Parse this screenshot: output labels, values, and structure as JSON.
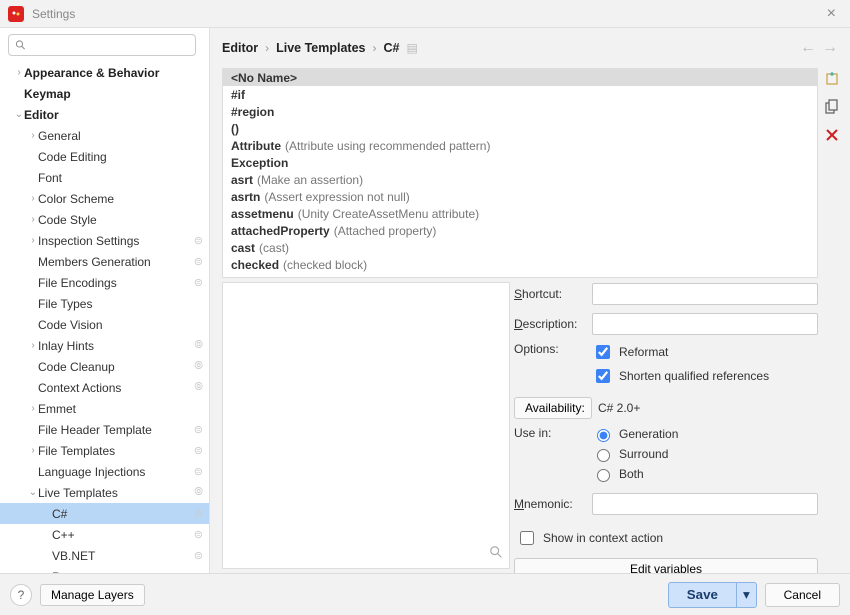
{
  "window": {
    "title": "Settings"
  },
  "search": {
    "placeholder": ""
  },
  "tree": [
    {
      "label": "Appearance & Behavior",
      "depth": 0,
      "chev": "›",
      "bold": true
    },
    {
      "label": "Keymap",
      "depth": 0,
      "chev": "",
      "bold": true
    },
    {
      "label": "Editor",
      "depth": 0,
      "chev": "⌄",
      "bold": true
    },
    {
      "label": "General",
      "depth": 1,
      "chev": "›"
    },
    {
      "label": "Code Editing",
      "depth": 1,
      "chev": ""
    },
    {
      "label": "Font",
      "depth": 1,
      "chev": ""
    },
    {
      "label": "Color Scheme",
      "depth": 1,
      "chev": "›"
    },
    {
      "label": "Code Style",
      "depth": 1,
      "chev": "›"
    },
    {
      "label": "Inspection Settings",
      "depth": 1,
      "chev": "›",
      "badge": "⊜"
    },
    {
      "label": "Members Generation",
      "depth": 1,
      "chev": "",
      "badge": "⊜"
    },
    {
      "label": "File Encodings",
      "depth": 1,
      "chev": "",
      "badge": "⊜"
    },
    {
      "label": "File Types",
      "depth": 1,
      "chev": ""
    },
    {
      "label": "Code Vision",
      "depth": 1,
      "chev": ""
    },
    {
      "label": "Inlay Hints",
      "depth": 1,
      "chev": "›",
      "badge": "⦾"
    },
    {
      "label": "Code Cleanup",
      "depth": 1,
      "chev": "",
      "badge": "⦾"
    },
    {
      "label": "Context Actions",
      "depth": 1,
      "chev": "",
      "badge": "⦾"
    },
    {
      "label": "Emmet",
      "depth": 1,
      "chev": "›"
    },
    {
      "label": "File Header Template",
      "depth": 1,
      "chev": "",
      "badge": "⊜"
    },
    {
      "label": "File Templates",
      "depth": 1,
      "chev": "›",
      "badge": "⊜"
    },
    {
      "label": "Language Injections",
      "depth": 1,
      "chev": "",
      "badge": "⊜"
    },
    {
      "label": "Live Templates",
      "depth": 1,
      "chev": "⌄",
      "badge": "⦾"
    },
    {
      "label": "C#",
      "depth": 2,
      "chev": "",
      "selected": true,
      "badge": "⊜"
    },
    {
      "label": "C++",
      "depth": 2,
      "chev": "",
      "badge": "⊜"
    },
    {
      "label": "VB.NET",
      "depth": 2,
      "chev": "",
      "badge": "⊜"
    },
    {
      "label": "Razor",
      "depth": 2,
      "chev": "",
      "badge": "⊜"
    }
  ],
  "breadcrumb": [
    "Editor",
    "Live Templates",
    "C#"
  ],
  "templates": [
    {
      "shortcut": "<No Name>",
      "desc": "",
      "selected": true
    },
    {
      "shortcut": "#if",
      "desc": ""
    },
    {
      "shortcut": "#region",
      "desc": ""
    },
    {
      "shortcut": "()",
      "desc": ""
    },
    {
      "shortcut": "Attribute",
      "desc": "(Attribute using recommended pattern)"
    },
    {
      "shortcut": "Exception",
      "desc": ""
    },
    {
      "shortcut": "asrt",
      "desc": "(Make an assertion)"
    },
    {
      "shortcut": "asrtn",
      "desc": "(Assert expression not null)"
    },
    {
      "shortcut": "assetmenu",
      "desc": "(Unity CreateAssetMenu attribute)"
    },
    {
      "shortcut": "attachedProperty",
      "desc": "(Attached property)"
    },
    {
      "shortcut": "cast",
      "desc": "(cast)"
    },
    {
      "shortcut": "checked",
      "desc": "(checked block)"
    }
  ],
  "form": {
    "shortcut_label": "hortcut:",
    "shortcut_u": "S",
    "shortcut_value": "",
    "description_label": "escription:",
    "description_u": "D",
    "description_value": "",
    "options_label": "Options:",
    "reformat": "Reformat",
    "shorten": "Shorten qualified references",
    "availability_label": "Availability:",
    "availability_value": "C# 2.0+",
    "usein_label": "Use in:",
    "generation": "Generation",
    "surround": "Surround",
    "both": "Both",
    "mnemonic_label": "nemonic:",
    "mnemonic_u": "M",
    "mnemonic_value": "",
    "show_ctx": "Show in context action",
    "edit_vars": "Edit variables"
  },
  "footer": {
    "help": "?",
    "manage": "Manage Layers",
    "save": "Save",
    "cancel": "Cancel"
  }
}
